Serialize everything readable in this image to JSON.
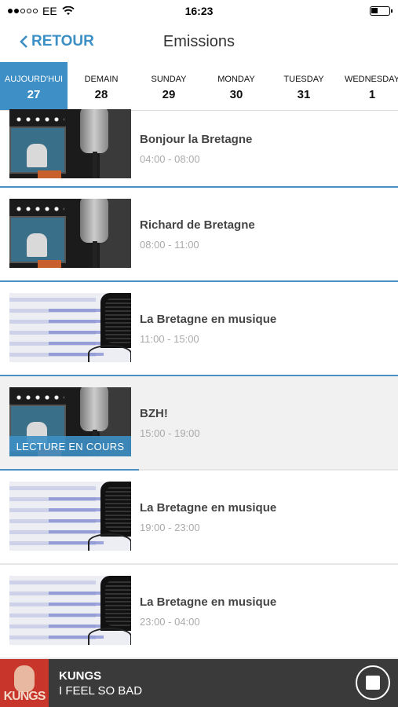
{
  "status_bar": {
    "carrier": "EE",
    "time": "16:23"
  },
  "nav": {
    "back_label": "RETOUR",
    "title": "Emissions"
  },
  "days": [
    {
      "name": "AUJOURD'HUI",
      "num": "27",
      "active": true
    },
    {
      "name": "DEMAIN",
      "num": "28"
    },
    {
      "name": "SUNDAY",
      "num": "29"
    },
    {
      "name": "MONDAY",
      "num": "30"
    },
    {
      "name": "TUESDAY",
      "num": "31"
    },
    {
      "name": "WEDNESDAY",
      "num": "1"
    }
  ],
  "shows": [
    {
      "title": "Bonjour la Bretagne",
      "time": "04:00 - 08:00",
      "thumb": "studio"
    },
    {
      "title": "Richard de Bretagne",
      "time": "08:00 - 11:00",
      "thumb": "studio"
    },
    {
      "title": "La Bretagne en musique",
      "time": "11:00 - 15:00",
      "thumb": "waveform"
    },
    {
      "title": "BZH!",
      "time": "15:00 - 19:00",
      "thumb": "studio",
      "now_playing_label": "LECTURE EN COURS",
      "progress": 0.35
    },
    {
      "title": "La Bretagne en musique",
      "time": "19:00 - 23:00",
      "thumb": "waveform"
    },
    {
      "title": "La Bretagne en musique",
      "time": "23:00 - 04:00",
      "thumb": "waveform"
    }
  ],
  "player": {
    "album_text": "KUNGS",
    "artist": "KUNGS",
    "track": "I FEEL SO BAD",
    "control": "stop-icon"
  },
  "colors": {
    "accent": "#3d8fc5",
    "player_bg": "#3a3a3a"
  }
}
